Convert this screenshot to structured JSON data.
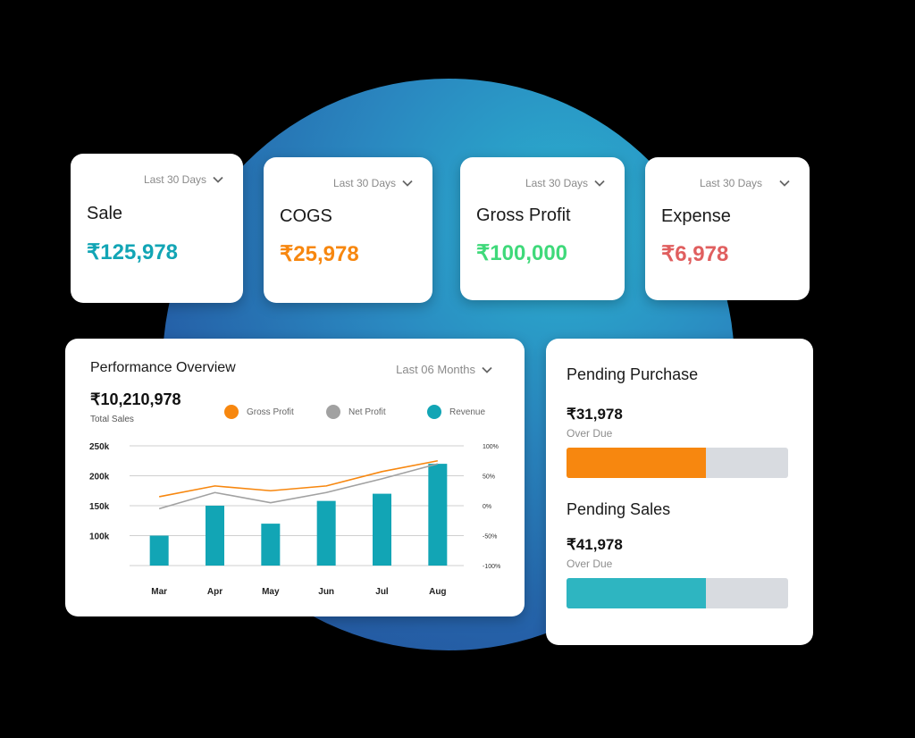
{
  "stats": [
    {
      "title": "Sale",
      "value": "₹125,978",
      "period": "Last 30 Days",
      "color": "#12a5b5"
    },
    {
      "title": "COGS",
      "value": "₹25,978",
      "period": "Last 30 Days",
      "color": "#f7870f"
    },
    {
      "title": "Gross Profit",
      "value": "₹100,000",
      "period": "Last 30 Days",
      "color": "#3fd97a"
    },
    {
      "title": "Expense",
      "value": "₹6,978",
      "period": "Last 30 Days",
      "color": "#e05f5f"
    }
  ],
  "performance": {
    "title": "Performance Overview",
    "period": "Last 06 Months",
    "total": "₹10,210,978",
    "total_label": "Total Sales",
    "legend": [
      {
        "label": "Gross Profit",
        "color": "#f7870f"
      },
      {
        "label": "Net Profit",
        "color": "#a1a1a1"
      },
      {
        "label": "Revenue",
        "color": "#12a5b5"
      }
    ]
  },
  "pending": {
    "purchase": {
      "title": "Pending Purchase",
      "value": "₹31,978",
      "sub": "Over Due",
      "fill": 0.63,
      "color": "#f7870f"
    },
    "sales": {
      "title": "Pending Sales",
      "value": "₹41,978",
      "sub": "Over Due",
      "fill": 0.63,
      "color": "#2eb5c1"
    }
  },
  "chart_data": {
    "type": "bar",
    "categories": [
      "Mar",
      "Apr",
      "May",
      "Jun",
      "Jul",
      "Aug"
    ],
    "series": [
      {
        "name": "Revenue",
        "type": "bar",
        "values": [
          100,
          150,
          120,
          158,
          170,
          220
        ]
      },
      {
        "name": "Gross Profit",
        "type": "line",
        "axis": "right",
        "values": [
          15,
          33,
          25,
          33,
          57,
          75
        ]
      },
      {
        "name": "Net Profit",
        "type": "line",
        "axis": "right",
        "values": [
          -5,
          22,
          5,
          22,
          45,
          70
        ]
      }
    ],
    "y_ticks": [
      "250k",
      "200k",
      "150k",
      "100k"
    ],
    "y2_ticks": [
      "100%",
      "50%",
      "0%",
      "-50%",
      "-100%"
    ],
    "ylim": [
      50,
      250
    ],
    "y2lim": [
      -100,
      100
    ],
    "grid": true
  }
}
